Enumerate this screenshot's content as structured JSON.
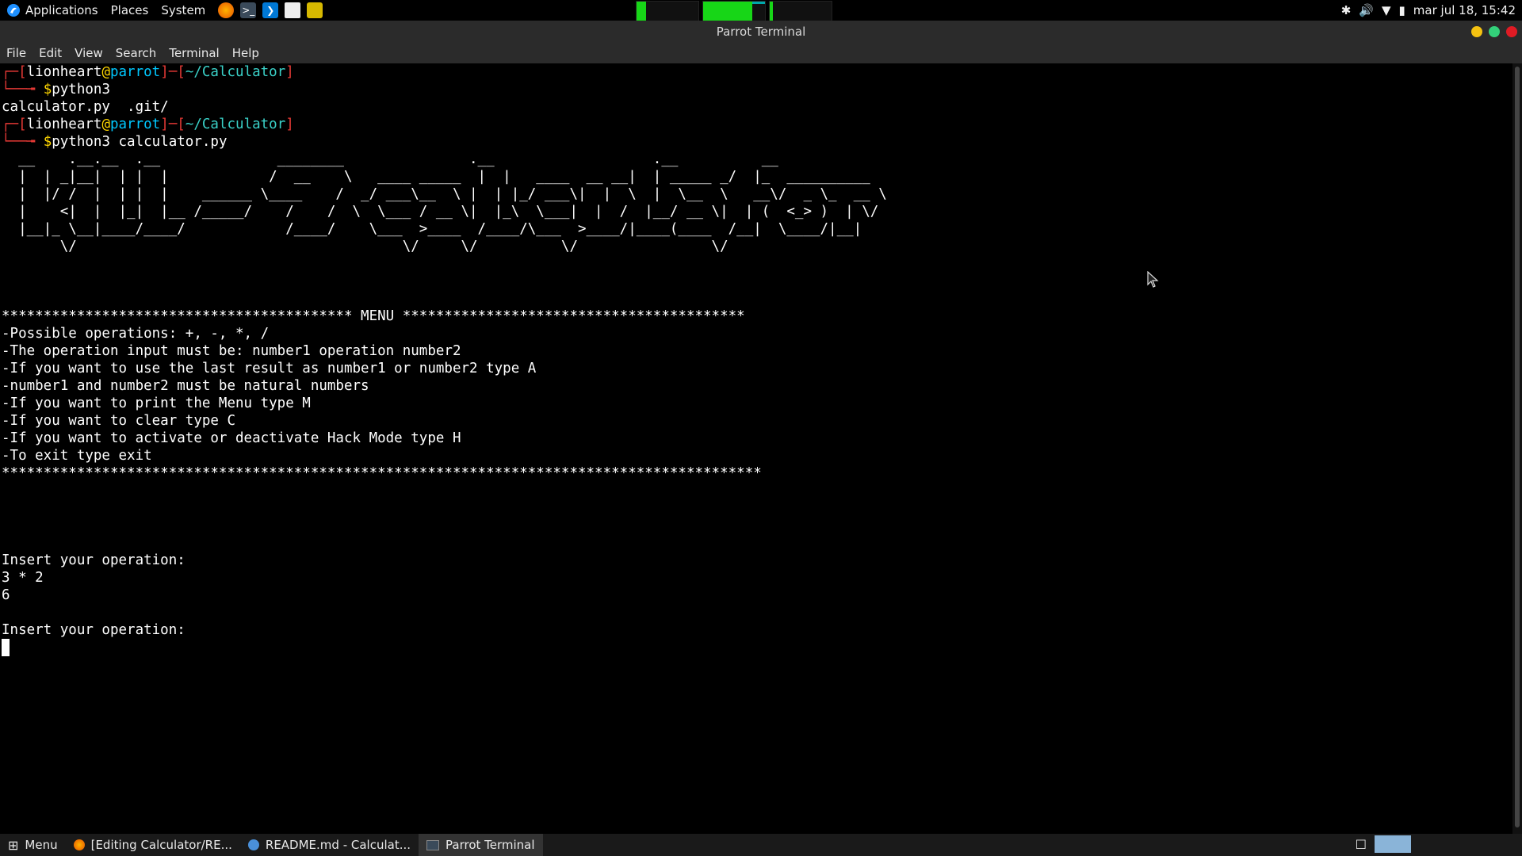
{
  "top_panel": {
    "menus": [
      "Applications",
      "Places",
      "System"
    ],
    "launchers": [
      "firefox-icon",
      "terminal-icon",
      "vscode-icon",
      "text-editor-icon",
      "screenshot-icon"
    ],
    "monitors": [
      {
        "name": "cpu-monitor",
        "level": 0.15
      },
      {
        "name": "memory-monitor",
        "level": 0.8
      },
      {
        "name": "network-monitor",
        "level": 0.05
      }
    ],
    "clock": "mar jul 18, 15:42"
  },
  "window": {
    "title": "Parrot Terminal",
    "menu": [
      "File",
      "Edit",
      "View",
      "Search",
      "Terminal",
      "Help"
    ]
  },
  "terminal": {
    "prompt1": {
      "user": "lionheart",
      "at": "@",
      "host": "parrot",
      "dir": "~/Calculator",
      "cmd": "python3"
    },
    "listing": "calculator.py  .git/",
    "prompt2": {
      "user": "lionheart",
      "at": "@",
      "host": "parrot",
      "dir": "~/Calculator",
      "cmd": "python3 calculator.py"
    },
    "banner": [
      "  __    .__.__  .__              ________               .__                   .__          __",
      "  |  | _|__|  | |  |            /  __    \\   ____ _____  |  |   ____  __ __|  | _____ _/  |_  __________",
      "  |  |/ /  |  | |  |    ______ \\____    /  _/ ___\\__  \\ |  | |_/ ___\\|  |  \\  |  \\__  \\   __\\/  _ \\_  __ \\",
      "  |    <|  |  |_|  |__ /_____/    /    /  \\  \\___ / __ \\|  |_\\  \\___|  |  /  |__/ __ \\|  | (  <_> )  | \\/",
      "  |__|_ \\__|____/____/            /____/    \\___  >____  /____/\\___  >____/|____(____  /__|  \\____/|__|",
      "       \\/                                       \\/     \\/          \\/                \\/"
    ],
    "menu_top": "****************************************** MENU *****************************************",
    "menu_lines": [
      "-Possible operations: +, -, *, /",
      "-The operation input must be: number1 operation number2",
      "-If you want to use the last result as number1 or number2 type A",
      "-number1 and number2 must be natural numbers",
      "-If you want to print the Menu type M",
      "-If you want to clear type C",
      "-If you want to activate or deactivate Hack Mode type H",
      "-To exit type exit"
    ],
    "menu_bottom": "*******************************************************************************************",
    "prompt_op": "Insert your operation:",
    "op_input": "3 * 2",
    "op_result": "6",
    "prompt_op2": "Insert your operation:"
  },
  "bottom_panel": {
    "menu_label": "Menu",
    "tasks": [
      {
        "label": "[Editing Calculator/RE...",
        "icon": "firefox-icon",
        "active": false
      },
      {
        "label": "README.md - Calculat...",
        "icon": "vscode-icon",
        "active": false
      },
      {
        "label": "Parrot Terminal",
        "icon": "terminal-icon",
        "active": true
      }
    ]
  }
}
